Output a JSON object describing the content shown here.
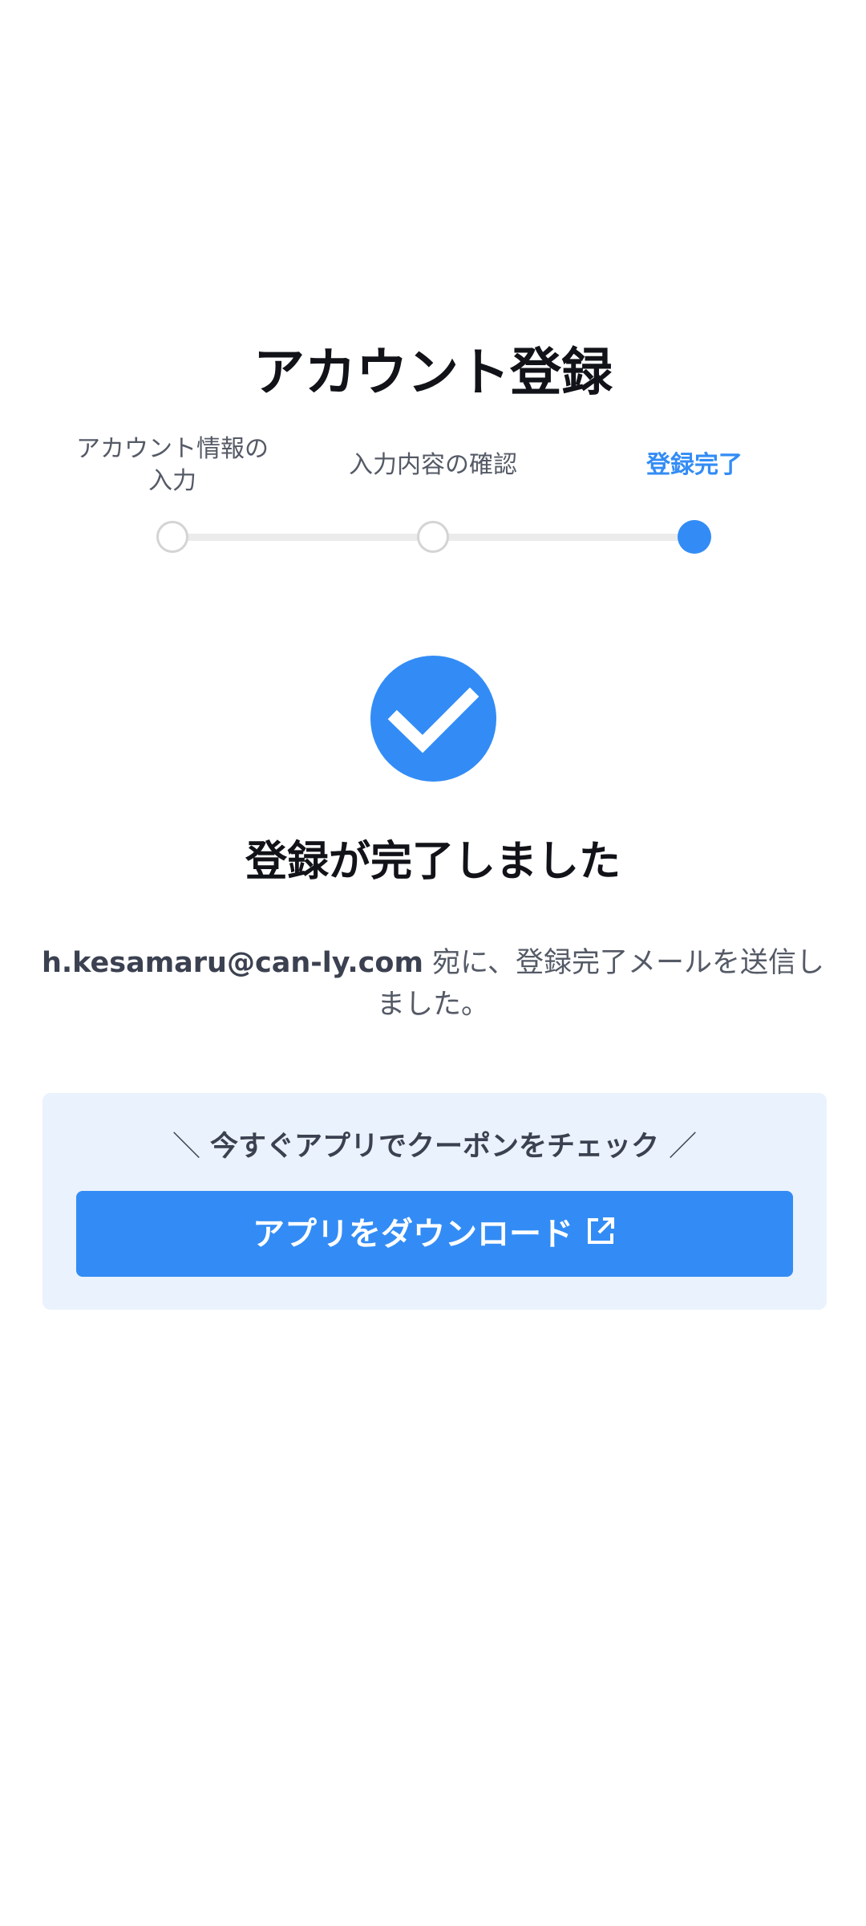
{
  "header": {
    "title": "アカウント登録"
  },
  "stepper": {
    "steps": [
      {
        "label_line1": "アカウント情報の",
        "label_line2": "入力",
        "state": "done"
      },
      {
        "label": "入力内容の確認",
        "state": "done"
      },
      {
        "label": "登録完了",
        "state": "active"
      }
    ]
  },
  "success": {
    "icon": "check-circle-icon",
    "title": "登録が完了しました",
    "email": "h.kesamaru@can-ly.com",
    "message_suffix": " 宛に、登録完了メールを送信しました。"
  },
  "promo": {
    "slash_left": "＼",
    "caption": "今すぐアプリでクーポンをチェック",
    "slash_right": "／",
    "button_label": "アプリをダウンロード",
    "button_icon": "external-link-icon"
  },
  "colors": {
    "accent": "#338cf5",
    "promo_background": "#eaf2fd",
    "text_primary": "#111318",
    "text_secondary": "#545a66"
  }
}
